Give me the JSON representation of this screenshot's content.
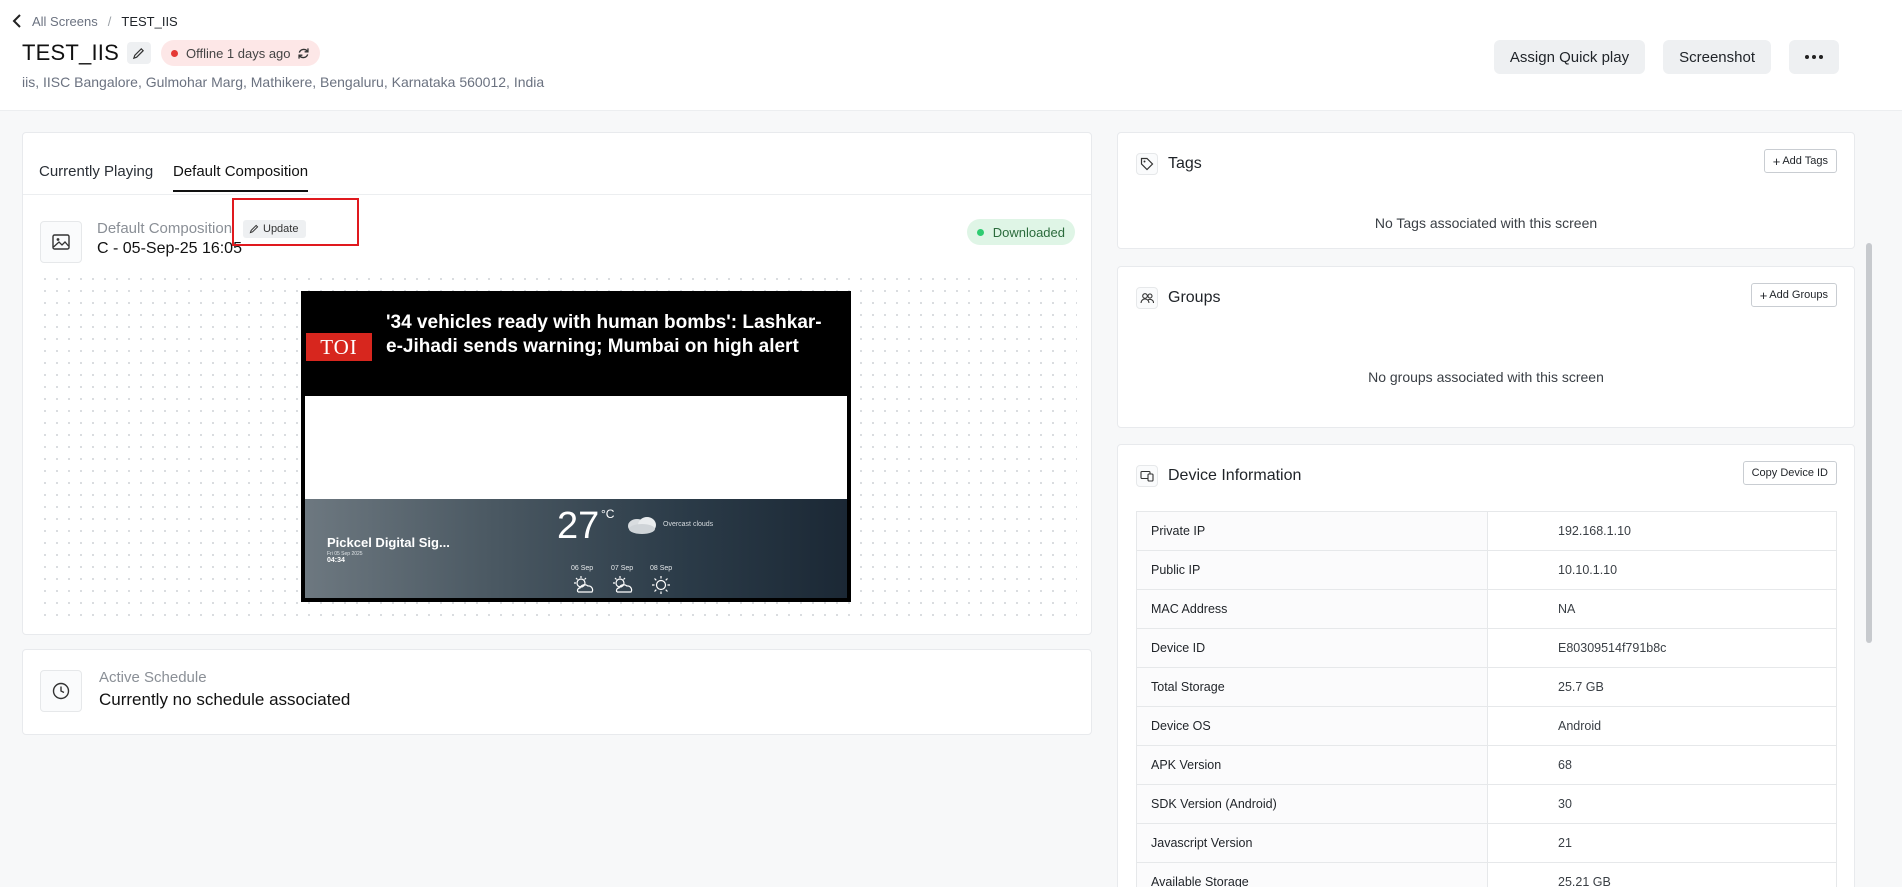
{
  "breadcrumb": {
    "parent": "All Screens",
    "separator": "/",
    "current": "TEST_IIS"
  },
  "screen": {
    "title": "TEST_IIS",
    "status": "Offline 1 days ago",
    "address": "iis, IISC Bangalore, Gulmohar Marg, Mathikere, Bengaluru, Karnataka 560012, India"
  },
  "actions": {
    "assign": "Assign Quick play",
    "screenshot": "Screenshot"
  },
  "tabs": [
    {
      "label": "Currently Playing",
      "active": false
    },
    {
      "label": "Default Composition",
      "active": true
    }
  ],
  "composition": {
    "label": "Default Composition",
    "update_label": "Update",
    "name": "C - 05-Sep-25 16:05",
    "status": "Downloaded"
  },
  "preview": {
    "logo": "TOI",
    "headline": "'34 vehicles ready with human bombs': Lashkar-e-Jihadi sends warning; Mumbai on high alert",
    "brand": "Pickcel Digital Sig...",
    "date": "Fri 05 Sep 2025",
    "time": "04:34",
    "temp": "27",
    "temp_unit": "°C",
    "condition": "Overcast clouds",
    "forecast": [
      "06 Sep",
      "07 Sep",
      "08 Sep"
    ]
  },
  "schedule": {
    "label": "Active Schedule",
    "value": "Currently no schedule associated"
  },
  "tags": {
    "title": "Tags",
    "add_label": "Add Tags",
    "empty": "No Tags associated with this screen"
  },
  "groups": {
    "title": "Groups",
    "add_label": "Add Groups",
    "empty": "No groups associated with this screen"
  },
  "device": {
    "title": "Device Information",
    "copy_label": "Copy Device ID",
    "rows": [
      {
        "key": "Private IP",
        "value": "192.168.1.10"
      },
      {
        "key": "Public IP",
        "value": "10.10.1.10"
      },
      {
        "key": "MAC Address",
        "value": "NA"
      },
      {
        "key": "Device ID",
        "value": "E80309514f791b8c"
      },
      {
        "key": "Total Storage",
        "value": "25.7 GB"
      },
      {
        "key": "Device OS",
        "value": "Android"
      },
      {
        "key": "APK Version",
        "value": "68"
      },
      {
        "key": "SDK Version (Android)",
        "value": "30"
      },
      {
        "key": "Javascript Version",
        "value": "21"
      },
      {
        "key": "Available Storage",
        "value": "25.21 GB"
      }
    ]
  },
  "colors": {
    "status_offline": "#e53935",
    "status_ok": "#2ecc71",
    "highlight": "#e0191e",
    "toi_red": "#d7261e"
  }
}
